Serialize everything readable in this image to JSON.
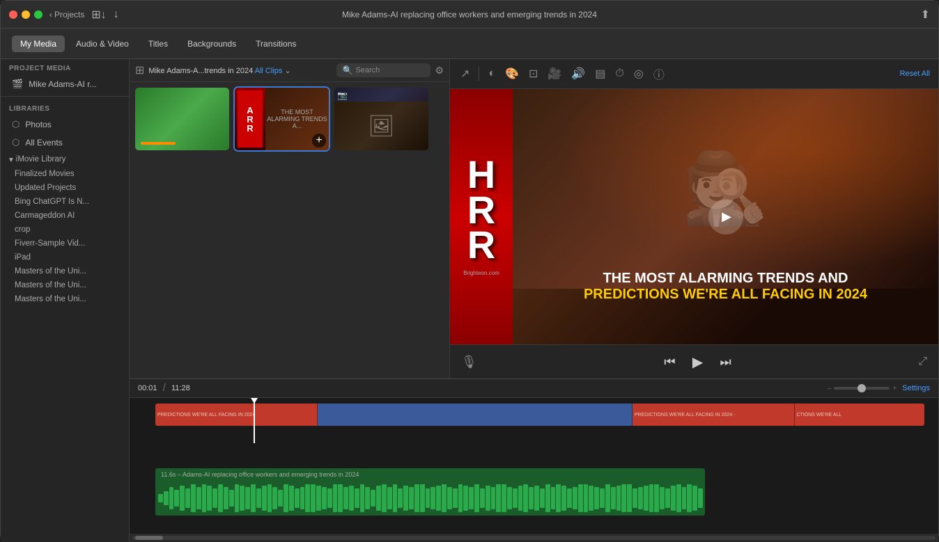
{
  "titleBar": {
    "title": "Mike Adams-AI replacing office workers and emerging trends in 2024",
    "projectsLabel": "Projects",
    "shareIcon": "↑"
  },
  "toolbar": {
    "tabs": [
      {
        "id": "my-media",
        "label": "My Media",
        "active": true
      },
      {
        "id": "audio-video",
        "label": "Audio & Video",
        "active": false
      },
      {
        "id": "titles",
        "label": "Titles",
        "active": false
      },
      {
        "id": "backgrounds",
        "label": "Backgrounds",
        "active": false
      },
      {
        "id": "transitions",
        "label": "Transitions",
        "active": false
      }
    ]
  },
  "sidebar": {
    "projectMediaLabel": "PROJECT MEDIA",
    "projectItem": "Mike Adams-AI r...",
    "librariesLabel": "LIBRARIES",
    "libraryItems": [
      {
        "label": "Photos",
        "icon": "⬡"
      },
      {
        "label": "All Events",
        "icon": "⬡"
      }
    ],
    "iMovieLibraryLabel": "iMovie Library",
    "treeItems": [
      "Finalized Movies",
      "Updated Projects",
      "Bing ChatGPT Is N...",
      "Carmageddon AI",
      "crop",
      "Fiverr-Sample Vid...",
      "iPad",
      "Masters of the Uni...",
      "Masters of the Uni...",
      "Masters of the Uni..."
    ]
  },
  "mediaBrowser": {
    "viewToggleIcon": "⊞",
    "titleText": "Mike Adams-A...trends in 2024",
    "filterText": "All Clips",
    "searchPlaceholder": "Search",
    "settingsIcon": "⚙"
  },
  "previewToolbar": {
    "tools": [
      {
        "id": "arrow",
        "label": "↗",
        "tooltip": "arrow tool"
      },
      {
        "id": "color-balance",
        "label": "◐",
        "tooltip": "color balance"
      },
      {
        "id": "color-correct",
        "label": "🎨",
        "tooltip": "color correct"
      },
      {
        "id": "crop",
        "label": "⊡",
        "tooltip": "crop"
      },
      {
        "id": "camera",
        "label": "🎥",
        "tooltip": "camera"
      },
      {
        "id": "audio",
        "label": "🔊",
        "tooltip": "audio"
      },
      {
        "id": "bars",
        "label": "▤",
        "tooltip": "bars"
      },
      {
        "id": "speed",
        "label": "⏱",
        "tooltip": "speed"
      },
      {
        "id": "overlap",
        "label": "◎",
        "tooltip": "overlap"
      },
      {
        "id": "info",
        "label": "ⓘ",
        "tooltip": "info"
      }
    ],
    "resetAllLabel": "Reset All"
  },
  "preview": {
    "hrrLetters": [
      "H",
      "R",
      "R"
    ],
    "logoText": "Brighteon.com",
    "titleLine1": "THE MOST ALARMING TRENDS AND",
    "titleLine2": "PREDICTIONS WE'RE ALL FACING IN 2024",
    "playIcon": "▶"
  },
  "previewControls": {
    "micIcon": "🎙",
    "rewindIcon": "⏮",
    "playIcon": "▶",
    "forwardIcon": "⏭",
    "expandIcon": "⤢"
  },
  "timeline": {
    "currentTime": "00:01",
    "totalTime": "11:28",
    "settingsLabel": "Settings",
    "videoSegments": [
      {
        "label": "PREDICTIONS WE'RE ALL FACING IN 2024",
        "type": "title"
      },
      {
        "label": "",
        "type": "video"
      },
      {
        "label": "PREDICTIONS WE'RE ALL FACING IN 2024 -",
        "type": "title"
      },
      {
        "label": "CTIONS WE'RE ALL",
        "type": "title"
      }
    ],
    "audioLabel": "11.6s – Adams-AI replacing office workers and emerging trends in 2024",
    "waveformBars": [
      3,
      5,
      8,
      6,
      9,
      7,
      10,
      8,
      11,
      9,
      7,
      12,
      8,
      6,
      10,
      9,
      8,
      11,
      7,
      9,
      10,
      8,
      6,
      11,
      9,
      7,
      8,
      10,
      12,
      9,
      8,
      7,
      10,
      11,
      8,
      9,
      7,
      10,
      8,
      6,
      9,
      11,
      8,
      10,
      7,
      9,
      8,
      11,
      10,
      7,
      8,
      9,
      10,
      8,
      7,
      11,
      9,
      8,
      10,
      7,
      9,
      8,
      11,
      10,
      8,
      7,
      9,
      10,
      8,
      9,
      7,
      11,
      8,
      10,
      9,
      7,
      8,
      10,
      11,
      9,
      8,
      7,
      10,
      8,
      9,
      11,
      10,
      7,
      8,
      9,
      11,
      10,
      8,
      7,
      9,
      10,
      8,
      11,
      9,
      7
    ]
  }
}
